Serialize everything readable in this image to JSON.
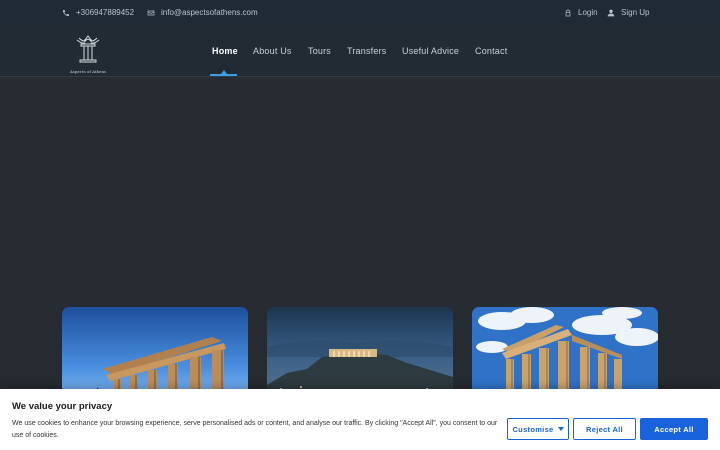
{
  "topbar": {
    "phone": "+306947889452",
    "email": "info@aspectsofathens.com",
    "login_label": "Login",
    "signup_label": "Sign Up"
  },
  "logo": {
    "text": "Aspects of Athens"
  },
  "nav": {
    "items": [
      {
        "label": "Home",
        "active": true
      },
      {
        "label": "About Us"
      },
      {
        "label": "Tours"
      },
      {
        "label": "Transfers"
      },
      {
        "label": "Useful Advice"
      },
      {
        "label": "Contact"
      }
    ]
  },
  "cookie": {
    "title": "We value your privacy",
    "text": "We use cookies to enhance your browsing experience, serve personalised ads or content, and analyse our traffic. By clicking \"Accept All\", you consent to our use of cookies.",
    "customise_label": "Customise",
    "reject_label": "Reject All",
    "accept_label": "Accept All"
  },
  "colors": {
    "accent": "#3aa0e0",
    "cookie_button": "#1863dc",
    "topbar_bg": "#1f2a35",
    "page_bg": "#262b31"
  }
}
